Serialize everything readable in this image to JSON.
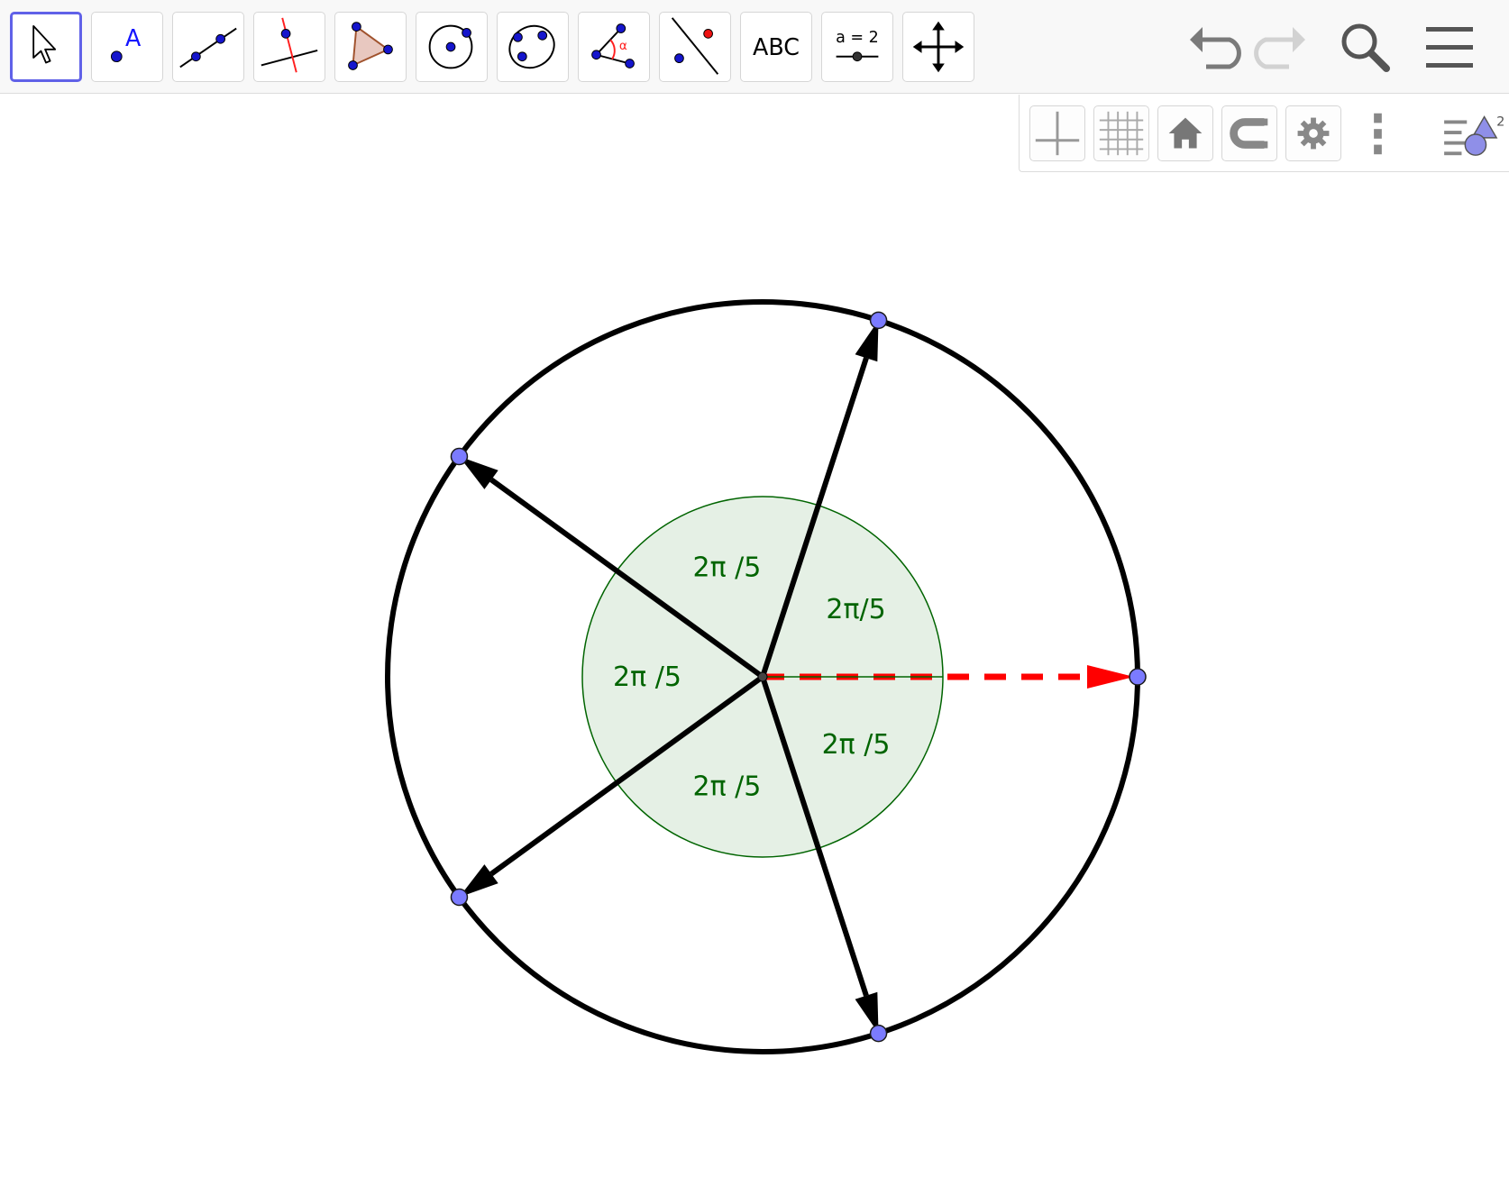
{
  "toolbar": {
    "tools": [
      {
        "name": "move-tool",
        "selected": true
      },
      {
        "name": "point-tool",
        "glyph": "A"
      },
      {
        "name": "line-tool"
      },
      {
        "name": "perpendicular-line-tool"
      },
      {
        "name": "polygon-tool"
      },
      {
        "name": "circle-center-point-tool"
      },
      {
        "name": "conic-through-points-tool"
      },
      {
        "name": "angle-tool",
        "glyph": "α"
      },
      {
        "name": "reflect-tool"
      },
      {
        "name": "text-tool",
        "label": "ABC"
      },
      {
        "name": "slider-tool",
        "label": "a = 2"
      },
      {
        "name": "move-graphics-view-tool"
      }
    ],
    "right_buttons": [
      "undo-icon",
      "redo-icon",
      "search-icon",
      "menu-icon"
    ]
  },
  "style_bar": {
    "buttons": [
      "axes-toggle-icon",
      "grid-toggle-icon",
      "home-icon",
      "point-capturing-icon",
      "settings-icon",
      "more-vert-icon",
      "graphics-view-2-icon"
    ],
    "view_badge": "2"
  },
  "graphics": {
    "outer_circle": {
      "stroke": "#000000"
    },
    "inner_circle": {
      "fill": "#e5f0e5",
      "stroke": "#006400"
    },
    "point_color": "#7b7bff",
    "vector_color": "#000000",
    "reference_vector": {
      "color": "#ff0000",
      "style": "dashed"
    },
    "vectors": [
      {
        "angle_deg": 72
      },
      {
        "angle_deg": 144
      },
      {
        "angle_deg": 216
      },
      {
        "angle_deg": 288
      }
    ],
    "angle_labels": [
      {
        "text": "2π/5",
        "angle_deg": 36
      },
      {
        "text": "2π /5",
        "angle_deg": 108
      },
      {
        "text": "2π /5",
        "angle_deg": 180
      },
      {
        "text": "2π /5",
        "angle_deg": 252
      },
      {
        "text": "2π /5",
        "angle_deg": 324
      }
    ]
  }
}
